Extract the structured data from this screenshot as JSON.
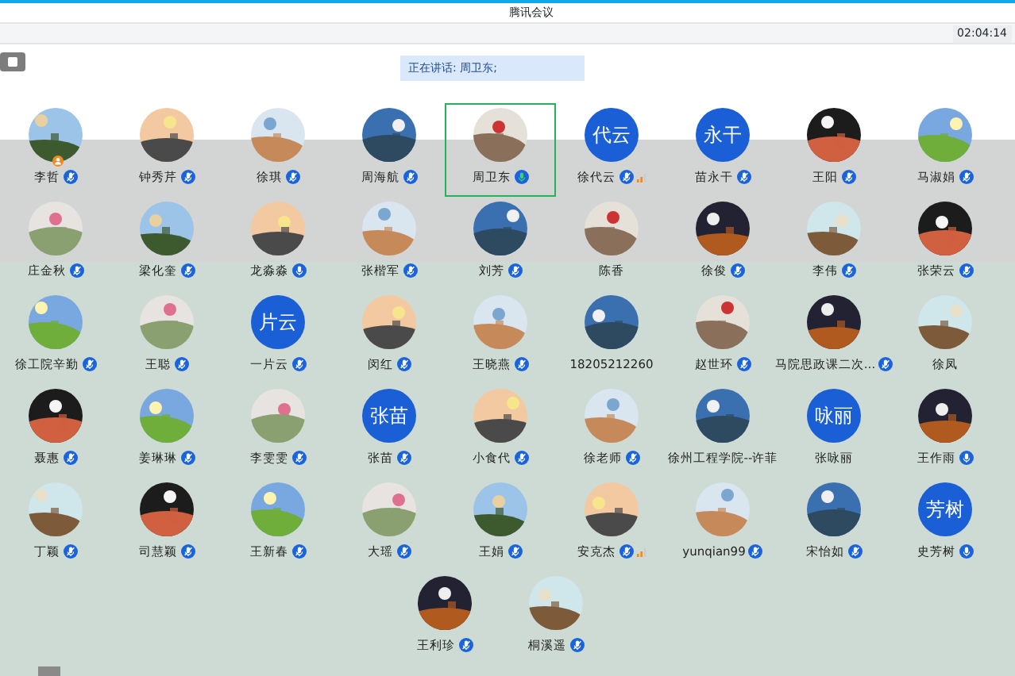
{
  "window": {
    "title": "腾讯会议"
  },
  "toolbar": {
    "timer": "02:04:14"
  },
  "speaking_banner": "正在讲话: 周卫东;",
  "participants": [
    {
      "name": "李哲",
      "mic": {
        "kind": "muted"
      },
      "host": true,
      "weak_signal": false,
      "speaking": false
    },
    {
      "name": "钟秀芹",
      "mic": {
        "kind": "muted"
      },
      "host": false,
      "weak_signal": false,
      "speaking": false
    },
    {
      "name": "徐琪",
      "mic": {
        "kind": "muted"
      },
      "host": false,
      "weak_signal": false,
      "speaking": false
    },
    {
      "name": "周海航",
      "mic": {
        "kind": "muted"
      },
      "host": false,
      "weak_signal": false,
      "speaking": false
    },
    {
      "name": "周卫东",
      "mic": {
        "kind": "speaking"
      },
      "host": false,
      "weak_signal": false,
      "speaking": true
    },
    {
      "name": "徐代云",
      "avatar": {
        "kind": "text",
        "text": "代云"
      },
      "mic": {
        "kind": "muted"
      },
      "host": false,
      "weak_signal": true,
      "speaking": false
    },
    {
      "name": "苗永干",
      "avatar": {
        "kind": "text",
        "text": "永干"
      },
      "mic": {
        "kind": "muted"
      },
      "host": false,
      "weak_signal": false,
      "speaking": false
    },
    {
      "name": "王阳",
      "mic": {
        "kind": "muted"
      },
      "host": false,
      "weak_signal": false,
      "speaking": false
    },
    {
      "name": "马淑娟",
      "mic": {
        "kind": "muted"
      },
      "host": false,
      "weak_signal": false,
      "speaking": false
    },
    {
      "name": "庄金秋",
      "mic": {
        "kind": "muted"
      },
      "host": false,
      "weak_signal": false,
      "speaking": false
    },
    {
      "name": "梁化奎",
      "mic": {
        "kind": "muted"
      },
      "host": false,
      "weak_signal": false,
      "speaking": false
    },
    {
      "name": "龙淼淼",
      "mic": {
        "kind": "on"
      },
      "host": false,
      "weak_signal": false,
      "speaking": false
    },
    {
      "name": "张楷军",
      "mic": {
        "kind": "muted"
      },
      "host": false,
      "weak_signal": false,
      "speaking": false
    },
    {
      "name": "刘芳",
      "mic": {
        "kind": "muted"
      },
      "host": false,
      "weak_signal": false,
      "speaking": false
    },
    {
      "name": "陈香",
      "host": false,
      "weak_signal": false,
      "speaking": false
    },
    {
      "name": "徐俊",
      "mic": {
        "kind": "muted"
      },
      "host": false,
      "weak_signal": false,
      "speaking": false
    },
    {
      "name": "李伟",
      "mic": {
        "kind": "muted"
      },
      "host": false,
      "weak_signal": false,
      "speaking": false
    },
    {
      "name": "张荣云",
      "mic": {
        "kind": "muted"
      },
      "host": false,
      "weak_signal": false,
      "speaking": false
    },
    {
      "name": "徐工院辛勤",
      "mic": {
        "kind": "muted"
      },
      "host": false,
      "weak_signal": false,
      "speaking": false
    },
    {
      "name": "王聪",
      "mic": {
        "kind": "muted"
      },
      "host": false,
      "weak_signal": false,
      "speaking": false
    },
    {
      "name": "一片云",
      "avatar": {
        "kind": "text",
        "text": "片云"
      },
      "mic": {
        "kind": "muted"
      },
      "host": false,
      "weak_signal": false,
      "speaking": false
    },
    {
      "name": "闵红",
      "mic": {
        "kind": "muted"
      },
      "host": false,
      "weak_signal": false,
      "speaking": false
    },
    {
      "name": "王晓燕",
      "mic": {
        "kind": "muted"
      },
      "host": false,
      "weak_signal": false,
      "speaking": false
    },
    {
      "name": "18205212260",
      "host": false,
      "weak_signal": false,
      "speaking": false
    },
    {
      "name": "赵世环",
      "mic": {
        "kind": "muted"
      },
      "host": false,
      "weak_signal": false,
      "speaking": false
    },
    {
      "name": "马院思政课二次...",
      "mic": {
        "kind": "muted"
      },
      "host": false,
      "weak_signal": false,
      "speaking": false
    },
    {
      "name": "徐凤",
      "host": false,
      "weak_signal": false,
      "speaking": false
    },
    {
      "name": "聂惠",
      "mic": {
        "kind": "muted"
      },
      "host": false,
      "weak_signal": false,
      "speaking": false
    },
    {
      "name": "姜琳琳",
      "mic": {
        "kind": "muted"
      },
      "host": false,
      "weak_signal": false,
      "speaking": false
    },
    {
      "name": "李雯雯",
      "mic": {
        "kind": "muted"
      },
      "host": false,
      "weak_signal": false,
      "speaking": false
    },
    {
      "name": "张苗",
      "avatar": {
        "kind": "text",
        "text": "张苗"
      },
      "mic": {
        "kind": "muted"
      },
      "host": false,
      "weak_signal": false,
      "speaking": false
    },
    {
      "name": "小食代",
      "mic": {
        "kind": "muted"
      },
      "host": false,
      "weak_signal": false,
      "speaking": false
    },
    {
      "name": "徐老师",
      "mic": {
        "kind": "muted"
      },
      "host": false,
      "weak_signal": false,
      "speaking": false
    },
    {
      "name": "徐州工程学院--许菲",
      "host": false,
      "weak_signal": false,
      "speaking": false
    },
    {
      "name": "张咏丽",
      "avatar": {
        "kind": "text",
        "text": "咏丽"
      },
      "host": false,
      "weak_signal": false,
      "speaking": false
    },
    {
      "name": "王作雨",
      "mic": {
        "kind": "on"
      },
      "host": false,
      "weak_signal": false,
      "speaking": false
    },
    {
      "name": "丁颖",
      "mic": {
        "kind": "muted"
      },
      "host": false,
      "weak_signal": false,
      "speaking": false
    },
    {
      "name": "司慧颖",
      "mic": {
        "kind": "muted"
      },
      "host": false,
      "weak_signal": false,
      "speaking": false
    },
    {
      "name": "王新春",
      "mic": {
        "kind": "muted"
      },
      "host": false,
      "weak_signal": false,
      "speaking": false
    },
    {
      "name": "大瑶",
      "mic": {
        "kind": "muted"
      },
      "host": false,
      "weak_signal": false,
      "speaking": false
    },
    {
      "name": "王娟",
      "mic": {
        "kind": "muted"
      },
      "host": false,
      "weak_signal": false,
      "speaking": false
    },
    {
      "name": "安克杰",
      "mic": {
        "kind": "muted"
      },
      "host": false,
      "weak_signal": true,
      "speaking": false
    },
    {
      "name": "yunqian99",
      "mic": {
        "kind": "muted"
      },
      "host": false,
      "weak_signal": false,
      "speaking": false
    },
    {
      "name": "宋怡如",
      "mic": {
        "kind": "muted"
      },
      "host": false,
      "weak_signal": false,
      "speaking": false
    },
    {
      "name": "史芳树",
      "avatar": {
        "kind": "text",
        "text": "芳树"
      },
      "mic": {
        "kind": "on"
      },
      "host": false,
      "weak_signal": false,
      "speaking": false
    },
    {
      "name": "王利珍",
      "mic": {
        "kind": "muted"
      },
      "host": false,
      "weak_signal": false,
      "speaking": false
    },
    {
      "name": "桐溪遥",
      "mic": {
        "kind": "muted"
      },
      "host": false,
      "weak_signal": false,
      "speaking": false
    }
  ]
}
